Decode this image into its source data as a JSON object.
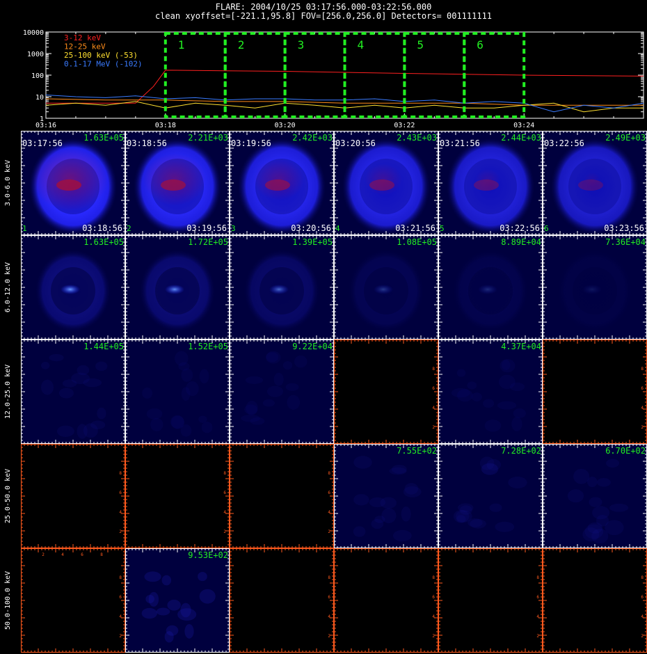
{
  "header": {
    "title": "FLARE: 2004/10/25 03:17:56.000-03:22:56.000",
    "subtitle": "clean   xyoffset=[-221.1,95.8]   FOV=[256.0,256.0]   Detectors= 001111111"
  },
  "colors": {
    "background": "#000000",
    "interval_box": "#22ee22",
    "grid_white": "#ffffff",
    "grid_orange": "#ff5a1e",
    "count_label": "#22ee22",
    "blob_blue": "#2020ff",
    "blob_red": "#aa1030"
  },
  "chart_data": [
    {
      "type": "line",
      "yscale": "log",
      "ylim": [
        1,
        10000
      ],
      "yticks": [
        "10000",
        "1000",
        "100",
        "10",
        "1"
      ],
      "xticks": [
        "03:16",
        "03:18",
        "03:20",
        "03:22",
        "03:24"
      ],
      "xlim_minutes": [
        0,
        10
      ],
      "legend_position": "top-left",
      "series": [
        {
          "name": "3-12 keV",
          "color": "#ff2020",
          "x": [
            0,
            0.8,
            1.5,
            1.8,
            2.0,
            3.0,
            4.0,
            5.0,
            6.0,
            7.0,
            8.0,
            9.0,
            10.0
          ],
          "y": [
            5,
            5,
            5,
            30,
            170,
            160,
            150,
            135,
            120,
            110,
            100,
            95,
            90
          ]
        },
        {
          "name": "12-25 keV",
          "color": "#ff8c1a",
          "x": [
            0,
            1.0,
            2.0,
            3.0,
            4.0,
            5.0,
            6.0,
            7.0,
            8.0,
            9.0,
            10.0
          ],
          "y": [
            8,
            7,
            7,
            6,
            6,
            5,
            5,
            5,
            4,
            4,
            4
          ]
        },
        {
          "name": "25-100 keV (-53)",
          "color": "#ffe030",
          "x": [
            0,
            0.5,
            1.0,
            1.5,
            2.0,
            2.5,
            3.0,
            3.5,
            4.0,
            4.5,
            5.0,
            5.5,
            6.0,
            6.5,
            7.0,
            7.5,
            8.0,
            8.5,
            9.0,
            9.5,
            10.0
          ],
          "y": [
            4,
            5,
            4,
            6,
            3,
            5,
            4,
            3,
            5,
            4,
            3,
            4,
            3,
            4,
            3,
            3,
            4,
            5,
            2,
            3,
            3
          ]
        },
        {
          "name": "0.1-17 MeV (-102)",
          "color": "#3a7bff",
          "x": [
            0,
            0.5,
            1.0,
            1.5,
            2.0,
            2.5,
            3.0,
            3.5,
            4.0,
            4.5,
            5.0,
            5.5,
            6.0,
            6.5,
            7.0,
            7.5,
            8.0,
            8.5,
            9.0,
            9.5,
            10.0
          ],
          "y": [
            12,
            10,
            9,
            11,
            8,
            9,
            7,
            8,
            8,
            7,
            7,
            8,
            6,
            7,
            5,
            6,
            5,
            2,
            4,
            3,
            5
          ]
        }
      ],
      "intervals": [
        {
          "label": "1",
          "start": 2.0,
          "end": 3.0
        },
        {
          "label": "2",
          "start": 3.0,
          "end": 4.0
        },
        {
          "label": "3",
          "start": 4.0,
          "end": 5.0
        },
        {
          "label": "4",
          "start": 5.0,
          "end": 6.0
        },
        {
          "label": "5",
          "start": 6.0,
          "end": 7.0
        },
        {
          "label": "6",
          "start": 7.0,
          "end": 8.0
        }
      ]
    },
    {
      "type": "heatmap",
      "rows": [
        "3.0-6.0 keV",
        "6.0-12.0 keV",
        "12.0-25.0 keV",
        "25.0-50.0 keV",
        "50.0-100.0 keV"
      ],
      "columns": [
        {
          "start": "03:17:56",
          "end": "03:18:56",
          "index": "1"
        },
        {
          "start": "03:18:56",
          "end": "03:19:56",
          "index": "2"
        },
        {
          "start": "03:19:56",
          "end": "03:20:56",
          "index": "3"
        },
        {
          "start": "03:20:56",
          "end": "03:21:56",
          "index": "4"
        },
        {
          "start": "03:21:56",
          "end": "03:22:56",
          "index": "5"
        },
        {
          "start": "03:22:56",
          "end": "03:23:56",
          "index": "6"
        }
      ],
      "max_counts": [
        [
          "1.63E+05",
          "2.21E+03",
          "2.42E+03",
          "2.43E+03",
          "2.44E+03",
          "2.49E+03"
        ],
        [
          "1.63E+05",
          "1.72E+05",
          "1.39E+05",
          "1.08E+05",
          "8.89E+04",
          "7.36E+04"
        ],
        [
          "1.44E+05",
          "1.52E+05",
          "9.22E+04",
          "",
          "4.37E+04",
          ""
        ],
        [
          "",
          "",
          "",
          "7.55E+02",
          "7.28E+02",
          "6.70E+02"
        ],
        [
          "",
          "9.53E+02",
          "",
          "",
          "",
          ""
        ]
      ],
      "brightness": [
        [
          1.0,
          0.95,
          0.9,
          0.85,
          0.8,
          0.75
        ],
        [
          0.55,
          0.5,
          0.38,
          0.2,
          0.15,
          0.08
        ],
        [
          0.05,
          0.04,
          0.04,
          0,
          0.04,
          0
        ],
        [
          0,
          0,
          0,
          0.05,
          0.05,
          0.05
        ],
        [
          0,
          0.12,
          0,
          0,
          0,
          0
        ]
      ],
      "red_core": [
        [
          0.9,
          0.75,
          0.6,
          0.45,
          0.3,
          0.2
        ],
        [
          0,
          0,
          0,
          0,
          0,
          0
        ],
        [
          0,
          0,
          0,
          0,
          0,
          0
        ],
        [
          0,
          0,
          0,
          0,
          0,
          0
        ],
        [
          0,
          0,
          0,
          0,
          0,
          0
        ]
      ],
      "empty_axis_labels": [
        "2",
        "4",
        "6",
        "8"
      ]
    }
  ]
}
